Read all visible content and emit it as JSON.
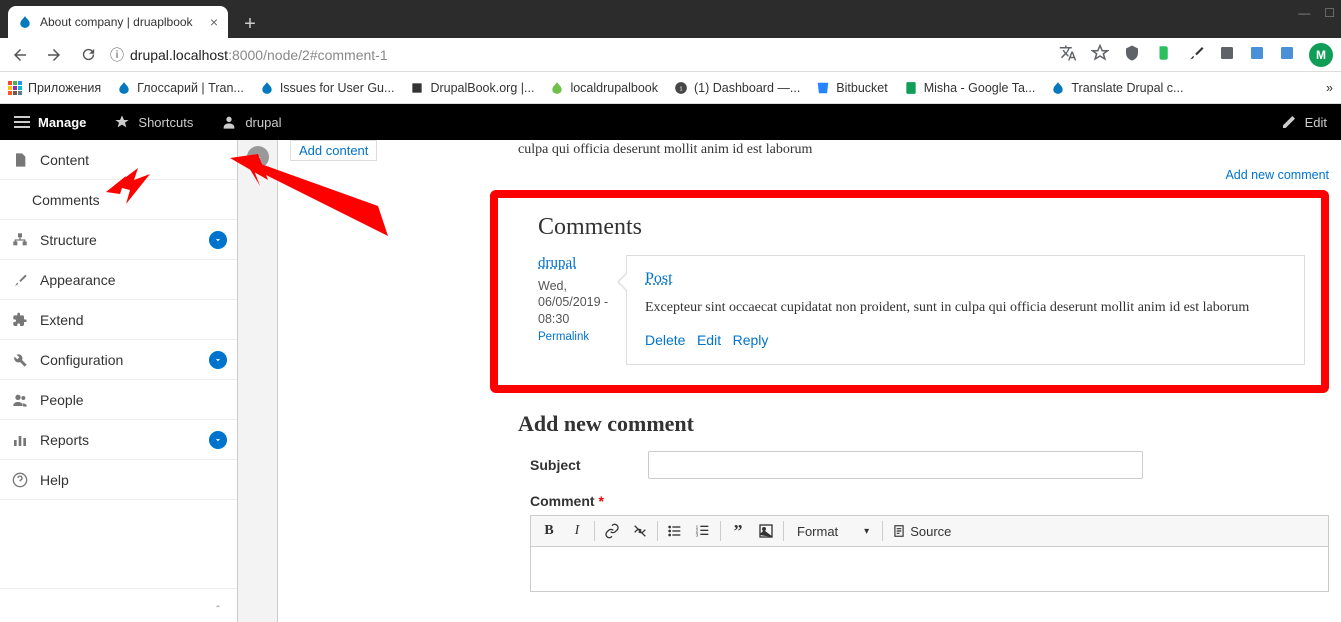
{
  "browser": {
    "tab_title": "About company | druaplbook",
    "url_info_icon": "ⓘ",
    "url_host": "drupal.localhost",
    "url_port": ":8000",
    "url_path": "/node/2#comment-1",
    "avatar_letter": "M"
  },
  "bookmarks": {
    "apps": "Приложения",
    "items": [
      "Глоссарий | Tran...",
      "Issues for User Gu...",
      "DrupalBook.org |...",
      "localdrupalbook",
      "(1) Dashboard —...",
      "Bitbucket",
      "Misha - Google Ta...",
      "Translate Drupal c..."
    ]
  },
  "toolbar": {
    "manage": "Manage",
    "shortcuts": "Shortcuts",
    "user": "drupal",
    "edit": "Edit"
  },
  "sidebar": {
    "content": "Content",
    "comments": "Comments",
    "structure": "Structure",
    "appearance": "Appearance",
    "extend": "Extend",
    "configuration": "Configuration",
    "people": "People",
    "reports": "Reports",
    "help": "Help"
  },
  "page": {
    "add_content": "Add content",
    "lorem_tail": "culpa qui officia deserunt mollit anim id est laborum",
    "add_new_comment_link": "Add new comment",
    "comments_heading": "Comments",
    "comment": {
      "author": "drupal",
      "date": "Wed, 06/05/2019 - 08:30",
      "permalink": "Permalink",
      "title": "Post",
      "body": "Excepteur sint occaecat cupidatat non proident, sunt in culpa qui officia deserunt mollit anim id est laborum",
      "delete": "Delete",
      "edit": "Edit",
      "reply": "Reply"
    },
    "add_comment_heading": "Add new comment",
    "subject_label": "Subject",
    "comment_label": "Comment",
    "required_mark": "*",
    "ck_format": "Format",
    "ck_source": "Source"
  }
}
